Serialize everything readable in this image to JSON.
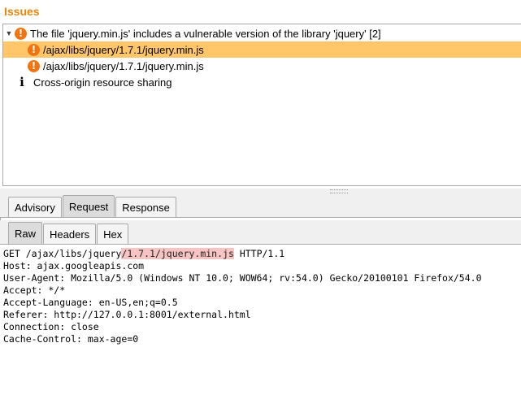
{
  "issues": {
    "title": "Issues",
    "group": {
      "label": "The file 'jquery.min.js' includes a vulnerable version of the library 'jquery' [2]",
      "children": [
        "/ajax/libs/jquery/1.7.1/jquery.min.js",
        "/ajax/libs/jquery/1.7.1/jquery.min.js"
      ]
    },
    "other": "Cross-origin resource sharing"
  },
  "tabs": {
    "advisory": "Advisory",
    "request": "Request",
    "response": "Response"
  },
  "subtabs": {
    "raw": "Raw",
    "headers": "Headers",
    "hex": "Hex"
  },
  "colors": {
    "title": "#e8870d",
    "selection": "#ffc76a",
    "warning": "#f2740f",
    "highlight": "#f7c3c3"
  },
  "request": {
    "line1_pre": "GET /ajax/libs/jquery",
    "line1_hl": "/1.7.1/jquery.min.js",
    "line1_post": " HTTP/1.1",
    "lines": [
      "Host: ajax.googleapis.com",
      "User-Agent: Mozilla/5.0 (Windows NT 10.0; WOW64; rv:54.0) Gecko/20100101 Firefox/54.0",
      "Accept: */*",
      "Accept-Language: en-US,en;q=0.5",
      "Referer: http://127.0.0.1:8001/external.html",
      "Connection: close",
      "Cache-Control: max-age=0"
    ]
  }
}
